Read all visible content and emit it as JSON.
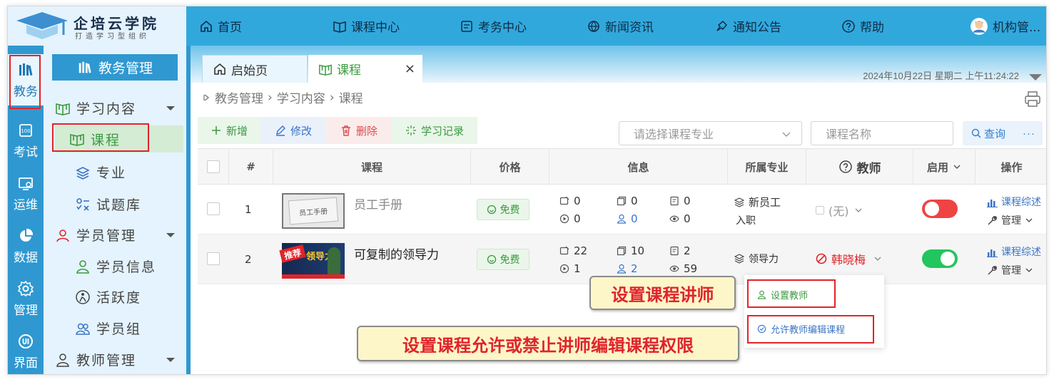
{
  "brand": {
    "name": "企培云学院",
    "slogan": "打造学习型组织"
  },
  "topnav": [
    {
      "label": "首页",
      "icon": "home-icon"
    },
    {
      "label": "课程中心",
      "icon": "book-icon"
    },
    {
      "label": "考务中心",
      "icon": "exam-icon"
    },
    {
      "label": "新闻资讯",
      "icon": "news-icon"
    },
    {
      "label": "通知公告",
      "icon": "notice-icon"
    },
    {
      "label": "帮助",
      "icon": "help-icon"
    },
    {
      "label": "机构管...",
      "icon": "avatar-icon"
    }
  ],
  "rail": [
    {
      "label": "教务",
      "icon": "library-icon"
    },
    {
      "label": "考试",
      "icon": "exam-icon"
    },
    {
      "label": "运维",
      "icon": "ops-icon"
    },
    {
      "label": "数据",
      "icon": "pie-chart-icon"
    },
    {
      "label": "管理",
      "icon": "gear-icon"
    },
    {
      "label": "界面",
      "icon": "ui-icon"
    }
  ],
  "sidebar": {
    "title": "教务管理",
    "items": [
      {
        "label": "学习内容",
        "icon": "book-icon",
        "group": true
      },
      {
        "label": "课程",
        "icon": "book-icon",
        "active": true
      },
      {
        "label": "专业",
        "icon": "stack-icon"
      },
      {
        "label": "试题库",
        "icon": "quiz-icon"
      },
      {
        "label": "学员管理",
        "icon": "student-icon",
        "group": true
      },
      {
        "label": "学员信息",
        "icon": "user-icon"
      },
      {
        "label": "活跃度",
        "icon": "activity-icon"
      },
      {
        "label": "学员组",
        "icon": "group-icon"
      },
      {
        "label": "教师管理",
        "icon": "teacher-icon",
        "group": true
      }
    ]
  },
  "tabs": [
    {
      "label": "启始页",
      "icon": "home-icon"
    },
    {
      "label": "课程",
      "icon": "book-icon",
      "close": "×"
    }
  ],
  "datetime": "2024年10月22日 星期二 上午11:24:22",
  "breadcrumb": [
    "教务管理",
    "学习内容",
    "课程"
  ],
  "breadcrumb_sep": "›",
  "toolbar": {
    "add": "新增",
    "edit": "修改",
    "delete": "删除",
    "log": "学习记录"
  },
  "search": {
    "major_placeholder": "请选择课程专业",
    "name_placeholder": "课程名称",
    "query": "查询",
    "more": "···"
  },
  "table": {
    "headers": {
      "index": "#",
      "course": "课程",
      "price": "价格",
      "info": "信息",
      "major": "所属专业",
      "teacher": "教师",
      "enabled": "启用",
      "ops": "操作"
    },
    "rows": [
      {
        "index": "1",
        "title": "员工手册",
        "price": "免费",
        "stats": [
          "0",
          "0",
          "0",
          "0",
          "0",
          "0"
        ],
        "major_line1": "新员工",
        "major_line2": "入职",
        "teacher": "(无)",
        "enabled": false,
        "op1": "课程综述",
        "op2": "管理"
      },
      {
        "index": "2",
        "title": "可复制的领导力",
        "price": "免费",
        "stats": [
          "22",
          "10",
          "2",
          "1",
          "2",
          "59"
        ],
        "major_line1": "领导力",
        "major_line2": "",
        "teacher": "韩晓梅",
        "enabled": true,
        "op1": "课程综述",
        "op2": "管理"
      }
    ]
  },
  "thumb1_text": "员工手册",
  "thumb2_badge": "推荐",
  "thumb2_text": "领导力",
  "menu": {
    "set_teacher": "设置教师",
    "allow_edit": "允许教师编辑课程"
  },
  "callouts": {
    "set_lecturer": "设置课程讲师",
    "permission": "设置课程允许或禁止讲师编辑课程权限"
  },
  "colors": {
    "topbar": "#31a8dc",
    "rail": "#2f98d1",
    "sidebar": "#e4f3fd",
    "green": "#3a9a3f",
    "red": "#e0242b",
    "toggle_on": "#22c55e",
    "toggle_off": "#ef4444"
  }
}
